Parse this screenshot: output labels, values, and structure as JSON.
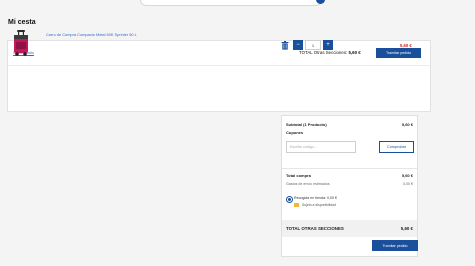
{
  "page": {
    "title": "Mi cesta"
  },
  "cart": {
    "empty_link": "Vaciar carrito",
    "total_label": "TOTAL Otras Secciones:",
    "total_value": "5,60 €",
    "checkout_label": "Tramitar pedido"
  },
  "product": {
    "name": "Carro de Compra Compacto Metal 50K Sprinter 50 L",
    "quantity": "1",
    "price": "5,60 €",
    "decrease_label": "−",
    "increase_label": "+"
  },
  "summary": {
    "subtotal_label": "Subtotal (1 Producto)",
    "subtotal_value": "5,60 €",
    "coupons_label": "Cupones",
    "coupon_placeholder": "Escribe código...",
    "check_label": "Comprobar",
    "total_label": "Total compra",
    "total_value": "5,60 €",
    "shipping_label": "Gastos de envío estimados",
    "shipping_value": "0,00 €",
    "pickup_label": "Recogida en tienda: 0,00 €",
    "availability_label": "Sujeto a disponibilidad",
    "grand_total_label": "TOTAL OTRAS SECCIONES",
    "grand_total_value": "5,60 €",
    "checkout_label": "Tramitar pedido"
  },
  "colors": {
    "accent": "#1a4f9c",
    "price": "#d01f1f",
    "link": "#2f6ad1",
    "badge": "#f2b63a"
  },
  "icons": {
    "trash": "trash-icon",
    "availability": "availability-badge"
  }
}
